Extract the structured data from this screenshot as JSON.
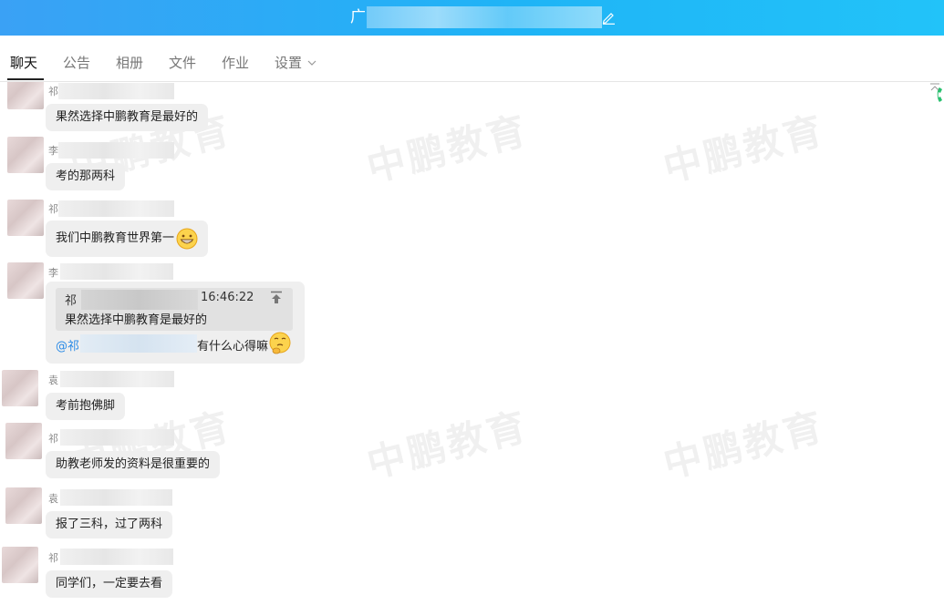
{
  "window": {
    "title_prefix": "广"
  },
  "tabs": [
    {
      "label": "聊天",
      "active": true
    },
    {
      "label": "公告"
    },
    {
      "label": "相册"
    },
    {
      "label": "文件"
    },
    {
      "label": "作业"
    },
    {
      "label": "设置",
      "has_dropdown": true
    }
  ],
  "watermark": "中鹏教育",
  "messages": [
    {
      "sender": "祁",
      "text": "果然选择中鹏教育是最好的"
    },
    {
      "sender": "李",
      "text": "考的那两科"
    },
    {
      "sender": "祁",
      "text": "我们中鹏教育世界第一",
      "emoji": "grin-emoji"
    },
    {
      "sender": "李",
      "quote": {
        "sender": "祁",
        "time": "16:46:22",
        "text": "果然选择中鹏教育是最好的"
      },
      "mention": "@祁",
      "text": "有什么心得嘛",
      "emoji": "thinking-emoji"
    },
    {
      "sender": "袁",
      "text": "考前抱佛脚"
    },
    {
      "sender": "祁",
      "text": "助教老师发的资料是很重要的"
    },
    {
      "sender": "袁",
      "text": "报了三科，过了两科"
    },
    {
      "sender": "祁",
      "text": "同学们，一定要去看"
    }
  ]
}
